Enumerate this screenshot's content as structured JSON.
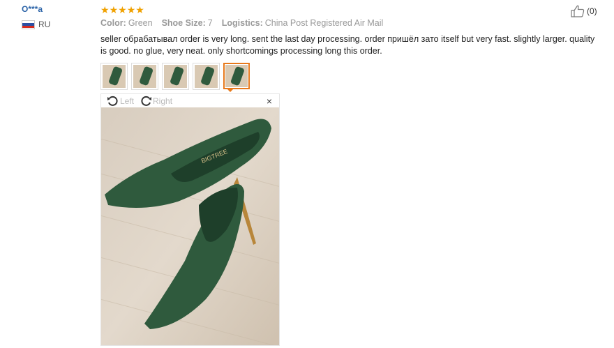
{
  "reviewer": {
    "name": "O***a",
    "country_code": "RU",
    "flag_colors": [
      "#ffffff",
      "#2a4fa3",
      "#d52b1e"
    ]
  },
  "review": {
    "rating": 5,
    "star_color": "#f0a100",
    "attributes": [
      {
        "label": "Color:",
        "value": "Green"
      },
      {
        "label": "Shoe Size:",
        "value": "7"
      },
      {
        "label": "Logistics:",
        "value": "China Post Registered Air Mail"
      }
    ],
    "text": "seller обрабатывал order is very long. sent the last day processing. order пришёл зато itself but very fast. slightly larger. quality is good. no glue, very neat. only shortcomings processing long this order."
  },
  "helpful": {
    "count": "(0)",
    "icon": "thumbs-up-icon"
  },
  "thumbnails": {
    "count": 5,
    "active_index": 4,
    "accent_color": "#e8791b"
  },
  "viewer": {
    "rotate_left_label": "Left",
    "rotate_right_label": "Right",
    "close_label": "×",
    "photo_brand_text": "BIGTREE"
  }
}
